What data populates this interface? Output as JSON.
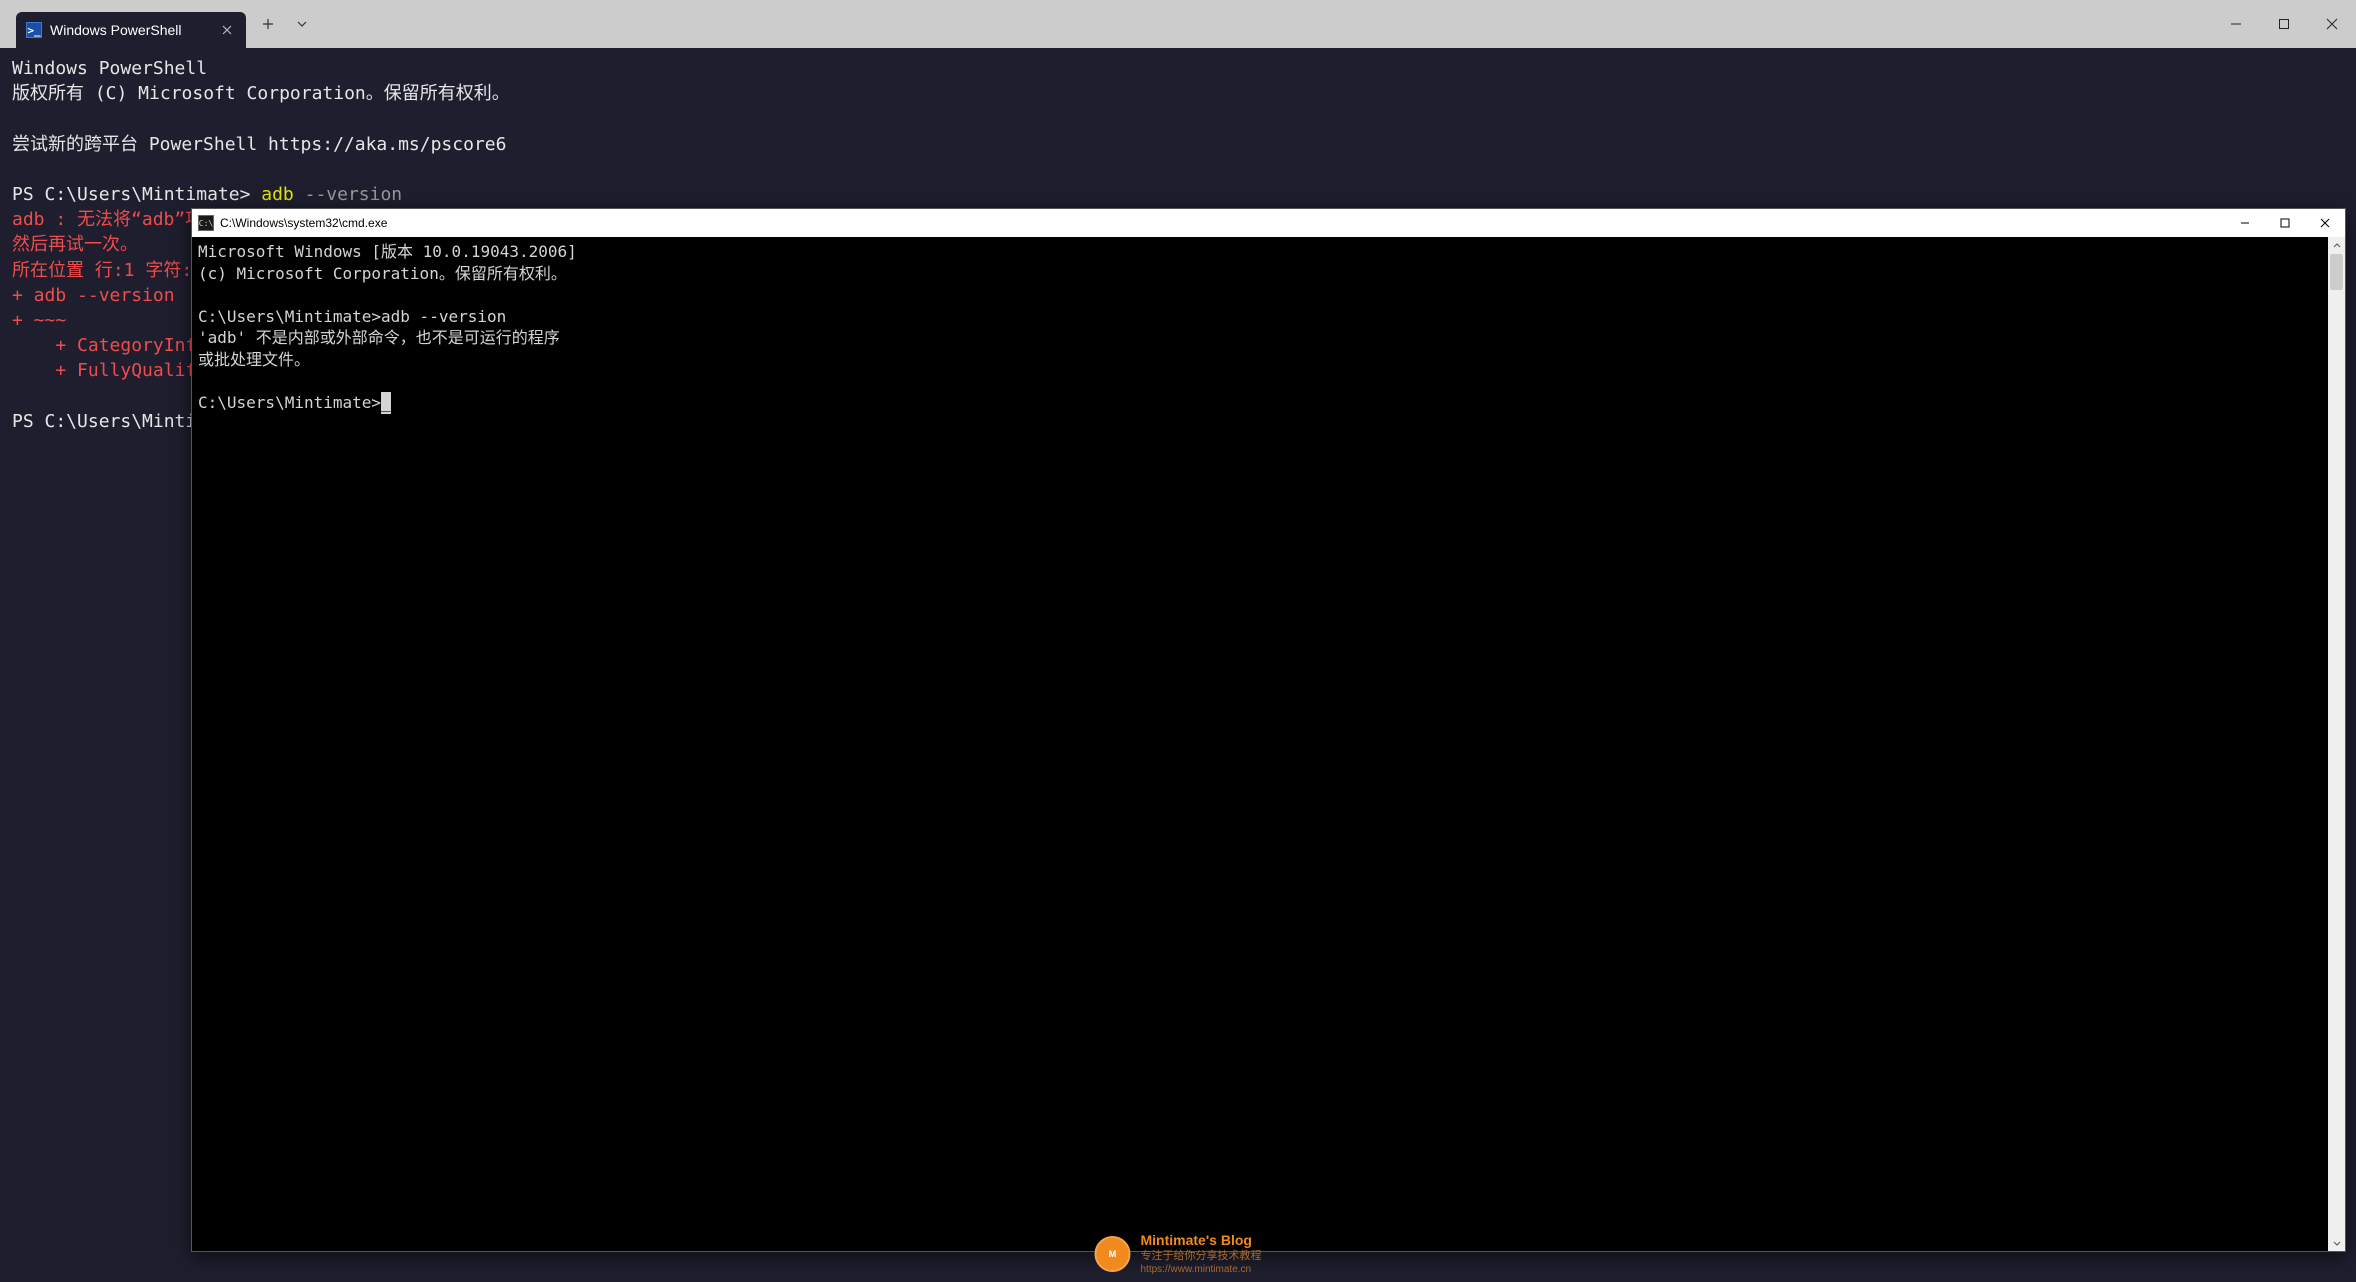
{
  "terminal": {
    "tab_title": "Windows PowerShell",
    "header_line1": "Windows PowerShell",
    "header_line2": "版权所有 (C) Microsoft Corporation。保留所有权利。",
    "header_line3": "尝试新的跨平台 PowerShell https://aka.ms/pscore6",
    "prompt1_prefix": "PS C:\\Users\\Mintimate> ",
    "prompt1_cmd": "adb",
    "prompt1_arg": " --version",
    "error_block": "adb : 无法将“adb”项识别为 cmdlet、函数、脚本文件或可运行程序的名称。请检查名称的拼写，如果包括路径，请确保路径正确，\n然后再试一次。\n所在位置 行:1 字符:\n+ adb --version\n+ ~~~\n    + CategoryInfo\n    + FullyQualifie",
    "prompt2": "PS C:\\Users\\Mintima"
  },
  "cmd": {
    "title": "C:\\Windows\\system32\\cmd.exe",
    "body": "Microsoft Windows [版本 10.0.19043.2006]\n(c) Microsoft Corporation。保留所有权利。\n\nC:\\Users\\Mintimate>adb --version\n'adb' 不是内部或外部命令，也不是可运行的程序\n或批处理文件。\n\nC:\\Users\\Mintimate>",
    "cursor": "_"
  },
  "watermark": {
    "title": "Mintimate's Blog",
    "subtitle": "专注于给你分享技术教程",
    "url": "https://www.mintimate.cn"
  }
}
